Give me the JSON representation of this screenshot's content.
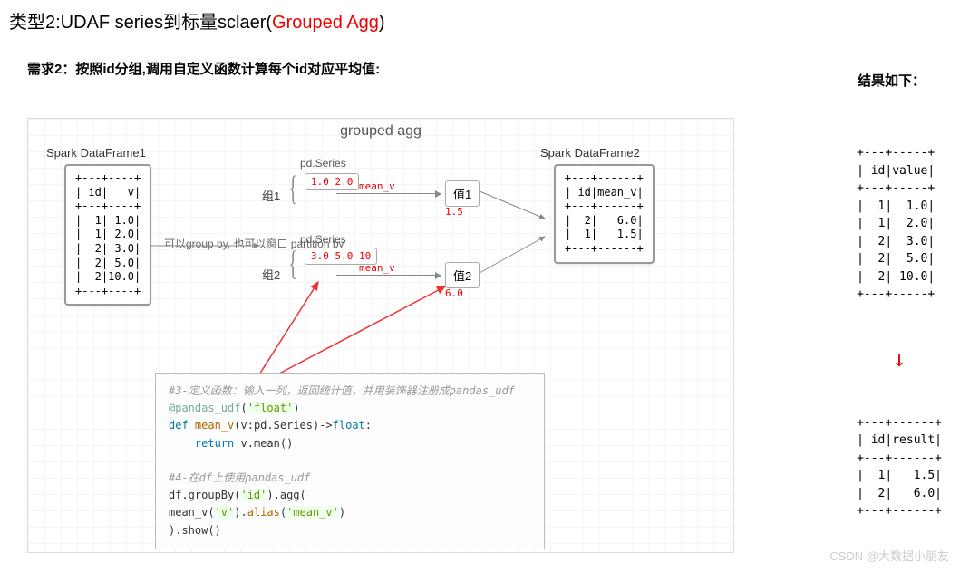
{
  "title": {
    "prefix": "类型2:UDAF series到标量sclaer(",
    "red": "Grouped Agg",
    "suffix": ")"
  },
  "subtitle": "需求2：按照id分组,调用自定义函数计算每个id对应平均值:",
  "result_label": "结果如下：",
  "diagram": {
    "title": "grouped agg",
    "df1_label": "Spark DataFrame1",
    "df1": "+---+----+\n| id|   v|\n+---+----+\n|  1| 1.0|\n|  1| 2.0|\n|  2| 3.0|\n|  2| 5.0|\n|  2|10.0|\n+---+----+",
    "df2_label": "Spark DataFrame2",
    "df2": "+---+------+\n| id|mean_v|\n+---+------+\n|  2|   6.0|\n|  1|   1.5|\n+---+------+",
    "note": "可以group by,\n也可以窗口\npartition by",
    "series1_label": "pd.Series",
    "series1": "1.0\n2.0",
    "series2_label": "pd.Series",
    "series2": "3.0\n5.0\n10",
    "group1": "组1",
    "group2": "组2",
    "meanv": "mean_v",
    "val1": "值1",
    "val1_num": "1.5",
    "val2": "值2",
    "val2_num": "6.0"
  },
  "code": {
    "c1": "#3-定义函数：输入一列，返回统计值，并用装饰器注册成pandas_udf",
    "deco": "@pandas_udf",
    "deco_arg": "'float'",
    "def": "def",
    "fn": "mean_v",
    "sig1": "(v:pd.Series)->",
    "rtype": "float",
    "sig2": ":",
    "ret": "return",
    "body": " v.mean()",
    "c2": "#4-在df上使用pandas_udf",
    "l4a": "df.groupBy(",
    "l4b": "'id'",
    "l4c": ").agg(",
    "l5a": "    mean_v(",
    "l5b": "'v'",
    "l5c": ").",
    "l5d": "alias",
    "l5e": "(",
    "l5f": "'mean_v'",
    "l5g": ")",
    "l6": ").show()"
  },
  "results": {
    "t1": "+---+-----+\n| id|value|\n+---+-----+\n|  1|  1.0|\n|  1|  2.0|\n|  2|  3.0|\n|  2|  5.0|\n|  2| 10.0|\n+---+-----+",
    "t2": "+---+------+\n| id|result|\n+---+------+\n|  1|   1.5|\n|  2|   6.0|\n+---+------+"
  },
  "watermark": "CSDN @大数据小朋友"
}
